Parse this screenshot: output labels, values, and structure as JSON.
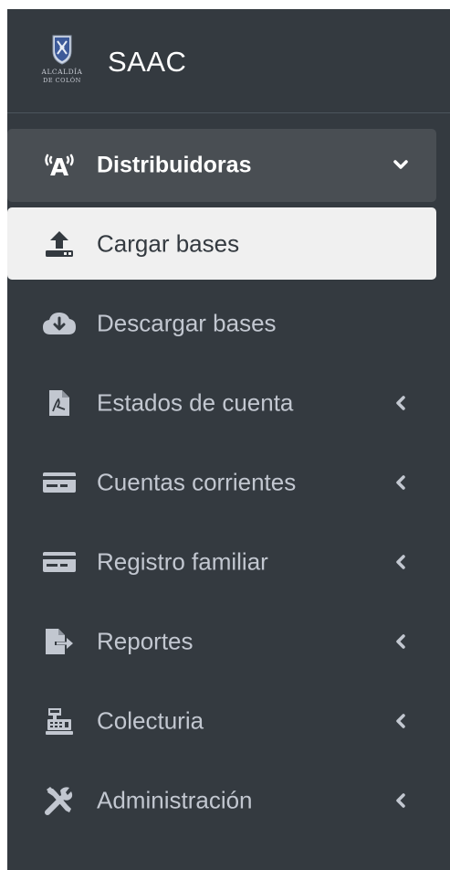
{
  "brand": {
    "text": "SAAC",
    "logo_icon": "alcaldia-de-colon-seal"
  },
  "menu": {
    "distribuidoras": {
      "label": "Distribuidoras",
      "icon": "broadcast-tower-icon",
      "state": "expanded"
    },
    "cargar_bases": {
      "label": "Cargar bases",
      "icon": "upload-icon",
      "state": "active"
    },
    "descargar_bases": {
      "label": "Descargar bases",
      "icon": "cloud-download-icon"
    },
    "estados_cuenta": {
      "label": "Estados de cuenta",
      "icon": "file-pdf-icon"
    },
    "cuentas_corrientes": {
      "label": "Cuentas corrientes",
      "icon": "id-card-icon"
    },
    "registro_familiar": {
      "label": "Registro familiar",
      "icon": "id-card-icon"
    },
    "reportes": {
      "label": "Reportes",
      "icon": "file-export-icon"
    },
    "colecturia": {
      "label": "Colecturia",
      "icon": "cash-register-icon"
    },
    "administracion": {
      "label": "Administración",
      "icon": "tools-icon"
    }
  },
  "colors": {
    "sidebar_bg": "#343a40",
    "open_item_bg": "#494e53",
    "active_item_bg": "#f0f0f0",
    "text": "#c2c7d0"
  }
}
